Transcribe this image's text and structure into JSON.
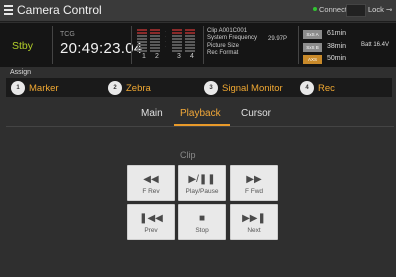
{
  "header": {
    "title": "Camera Control",
    "connection_status": "Connected",
    "lock_label": "Lock"
  },
  "status": {
    "mode": "Stby",
    "tc_label": "TCG",
    "timecode": "20:49:23.04",
    "audio_channels": [
      "1",
      "2",
      "3",
      "4"
    ],
    "clip_name": "Clip  A001C001",
    "system_frequency_label": "System Frequency",
    "system_frequency_value": "29.97P",
    "picture_size_label": "Picture Size",
    "rec_format_label": "Rec Format",
    "media": [
      {
        "slot": "SxS A",
        "remaining": "61min",
        "active": false
      },
      {
        "slot": "SxS B",
        "remaining": "38min",
        "active": false
      },
      {
        "slot": "AXS",
        "remaining": "50min",
        "active": true
      }
    ],
    "battery": "Batt  16.4V"
  },
  "assign": {
    "label": "Assign",
    "items": [
      {
        "number": "1",
        "label": "Marker"
      },
      {
        "number": "2",
        "label": "Zebra"
      },
      {
        "number": "3",
        "label": "Signal Monitor"
      },
      {
        "number": "4",
        "label": "Rec"
      }
    ]
  },
  "tabs": {
    "items": [
      "Main",
      "Playback",
      "Cursor"
    ],
    "active": "Playback"
  },
  "clip_section": {
    "title": "Clip",
    "buttons": [
      {
        "glyph": "◀◀",
        "label": "F Rev"
      },
      {
        "glyph": "▶/❚❚",
        "label": "Play/Pause"
      },
      {
        "glyph": "▶▶",
        "label": "F Fwd"
      },
      {
        "glyph": "❚◀◀",
        "label": "Prev"
      },
      {
        "glyph": "■",
        "label": "Stop"
      },
      {
        "glyph": "▶▶❚",
        "label": "Next"
      }
    ]
  },
  "colors": {
    "accent": "#f2a838",
    "standby": "#b3cf2a",
    "connected": "#31c431"
  }
}
